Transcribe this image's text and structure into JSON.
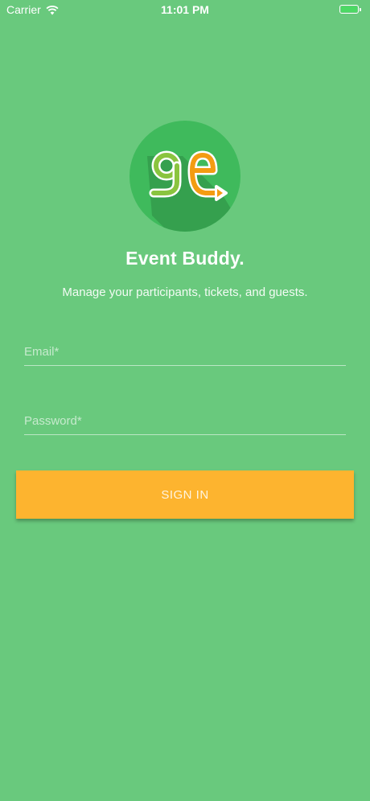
{
  "status_bar": {
    "carrier": "Carrier",
    "time": "11:01 PM",
    "wifi_icon": "wifi-icon",
    "battery_icon": "battery-icon"
  },
  "brand": {
    "logo_icon": "event-buddy-logo",
    "title": "Event Buddy.",
    "subtitle": "Manage your participants, tickets, and guests."
  },
  "form": {
    "email": {
      "placeholder": "Email*",
      "value": ""
    },
    "password": {
      "placeholder": "Password*",
      "value": ""
    },
    "signin_label": "SIGN IN"
  },
  "colors": {
    "background": "#69c97d",
    "logo_circle": "#3fba5c",
    "logo_shadow": "#349b4b",
    "logo_green": "#8ac43f",
    "logo_orange": "#f39c12",
    "button": "#fdb42f",
    "battery": "#4cd964"
  }
}
